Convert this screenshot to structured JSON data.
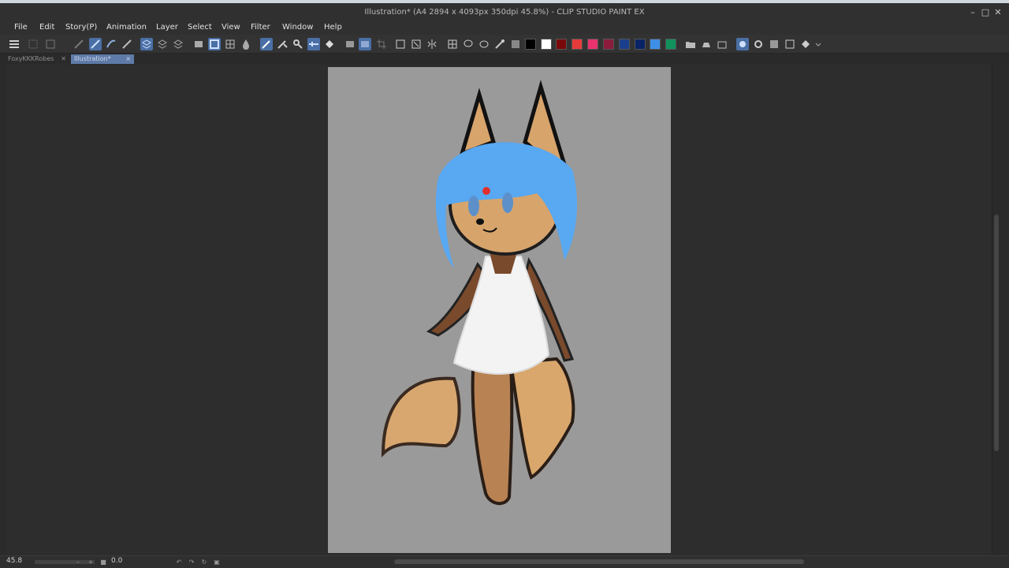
{
  "window": {
    "title": "Illustration* (A4 2894 x 4093px 350dpi 45.8%) - CLIP STUDIO PAINT EX"
  },
  "menu": [
    "File",
    "Edit",
    "Story(P)",
    "Animation",
    "Layer",
    "Select",
    "View",
    "Filter",
    "Window",
    "Help"
  ],
  "toolbar": {
    "swatches": [
      "#000000",
      "#ffffff",
      "#7a0a0a",
      "#e63b3b",
      "#e8336f",
      "#8a1c3c",
      "#1a3f8c",
      "#0a2366",
      "#3f8fe6",
      "#12915c"
    ]
  },
  "tabs": [
    {
      "label": "FoxyKKKRobes",
      "active": false
    },
    {
      "label": "Illustration*",
      "active": true
    }
  ],
  "status": {
    "zoom": "45.8",
    "rotation": "0.0"
  }
}
